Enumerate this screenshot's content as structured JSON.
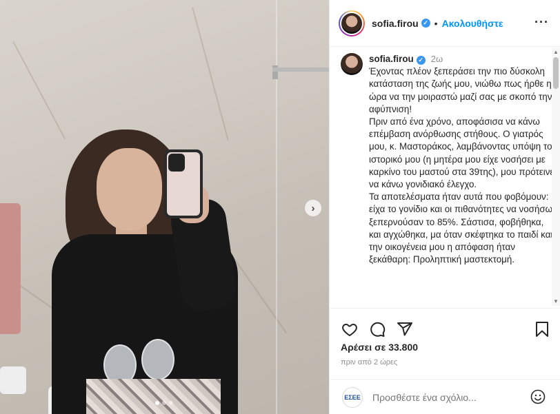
{
  "post": {
    "username": "sofia.firou",
    "follow_label": "Ακολουθήστε",
    "separator": "•",
    "more_label": "···",
    "caption": {
      "username": "sofia.firou",
      "time": "2ω",
      "text": "Έχοντας πλέον ξεπεράσει την πιο δύσκολη κατάσταση της ζωής μου, νιώθω πως ήρθε η ώρα να την μοιραστώ μαζί σας με σκοπό την αφύπνιση!\nΠριν από ένα χρόνο, αποφάσισα να κάνω επέμβαση ανόρθωσης στήθους. Ο γιατρός μου, κ. Μαστοράκος, λαμβάνοντας υπόψη το ιστορικό μου (η μητέρα μου είχε νοσήσει με καρκίνο του μαστού στα 39της), μου πρότεινε να κάνω γονιδιακό έλεγχο.\nΤα αποτελέσματα ήταν αυτά που φοβόμουν: είχα το γονίδιο και οι πιθανότητες να νοσήσω ξεπερνούσαν το 85%. Σάστισα, φοβήθηκα, και αγχώθηκα, μα όταν σκέφτηκα το παιδί και την οικογένεια μου η απόφαση ήταν ξεκάθαρη: Προληπτική μαστεκτομή."
    },
    "likes": "Αρέσει σε 33.800",
    "posted_ago": "πριν από 2 ώρες",
    "commenter_badge": "ΕΣΕΕ",
    "comment_placeholder": "Προσθέστε ένα σχόλιο...",
    "carousel": {
      "next_glyph": "›",
      "slides": 3,
      "active_slide": 1
    }
  },
  "colors": {
    "accent": "#0095f6",
    "verified": "#3897f0",
    "text": "#262626",
    "muted": "#8e8e8e"
  },
  "icons": [
    "heart-icon",
    "comment-icon",
    "share-icon",
    "bookmark-icon",
    "emoji-icon",
    "verified-icon",
    "more-icon",
    "chevron-right-icon"
  ]
}
